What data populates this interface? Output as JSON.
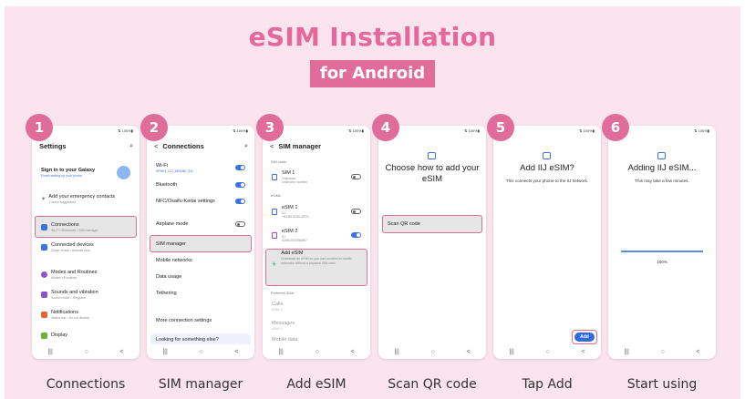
{
  "title": "eSIM Installation",
  "subtitle": "for Android",
  "status_text": "⇅ 100%▮",
  "nav_icons": [
    "|||",
    "○",
    "<"
  ],
  "steps": [
    {
      "number": "1",
      "caption": "Connections",
      "header": "Settings",
      "account": {
        "title": "Sign in to your Galaxy",
        "sub": "Finish setting up your phone"
      },
      "emergency": {
        "title": "Add your emergency contacts",
        "sub": "1 more suggestion"
      },
      "items": [
        {
          "title": "Connections",
          "sub": "Wi-Fi • Bluetooth • SIM manager"
        },
        {
          "title": "Connected devices",
          "sub": "Quick Share • Android Auto"
        },
        {
          "title": "Modes and Routines",
          "sub": "Modes • Routines"
        },
        {
          "title": "Sounds and vibration",
          "sub": "Sound mode • Ringtone"
        },
        {
          "title": "Notifications",
          "sub": "Status bar • Do not disturb"
        },
        {
          "title": "Display",
          "sub": ""
        }
      ]
    },
    {
      "number": "2",
      "caption": "SIM manager",
      "header": "Connections",
      "items": [
        {
          "title": "Wi-Fi",
          "sub": "SPWH_L12_6591BE_5G"
        },
        {
          "title": "Bluetooth"
        },
        {
          "title": "NFC/Osaifu-Keitai settings"
        },
        {
          "title": "Airplane mode"
        },
        {
          "title": "SIM manager"
        },
        {
          "title": "Mobile networks"
        },
        {
          "title": "Data usage"
        },
        {
          "title": "Tethering"
        },
        {
          "title": "More connection settings"
        },
        {
          "title": "Looking for something else?"
        }
      ]
    },
    {
      "number": "3",
      "caption": "Add eSIM",
      "header": "SIM manager",
      "sim_cards_label": "SIM cards",
      "sim1": {
        "title": "SIM 1",
        "sub1": "Unknown",
        "sub2": "Unknown number"
      },
      "esims_label": "eSIMs",
      "esim1": {
        "title": "eSIM 1",
        "sub1": "IIJ",
        "sub2": "+81 80-5700-8703"
      },
      "esim2": {
        "title": "eSIM 2",
        "sub1": "IIJ",
        "sub2": "02061022356897"
      },
      "add": {
        "title": "Add eSIM",
        "sub": "Download an eSIM so you can connect to mobile networks without a physical SIM card."
      },
      "preferred_label": "Preferred SIMs",
      "calls": {
        "title": "Calls",
        "sub": "eSIM 2"
      },
      "messages": {
        "title": "Messages",
        "sub": "eSIM 2"
      },
      "mobile_data": {
        "title": "Mobile data"
      }
    },
    {
      "number": "4",
      "caption": "Scan QR code",
      "heading": "Choose how to add your eSIM",
      "option": "Scan QR code"
    },
    {
      "number": "5",
      "caption": "Tap Add",
      "heading": "Add IIJ eSIM?",
      "text": "This connects your phone to the IIJ network.",
      "button": "Add"
    },
    {
      "number": "6",
      "caption": "Start using",
      "heading": "Adding IIJ eSIM...",
      "text": "This may take a few minutes.",
      "progress_label": "100%",
      "progress": 1.0
    }
  ],
  "colors": {
    "accent": "#e5679b",
    "badge": "#e06c99",
    "panel": "#fbe4ee",
    "blue": "#3b73e0"
  },
  "icons": [
    "search-icon",
    "back-arrow-icon",
    "sim-card-icon",
    "esim-icon",
    "plus-icon",
    "avatar-icon"
  ]
}
